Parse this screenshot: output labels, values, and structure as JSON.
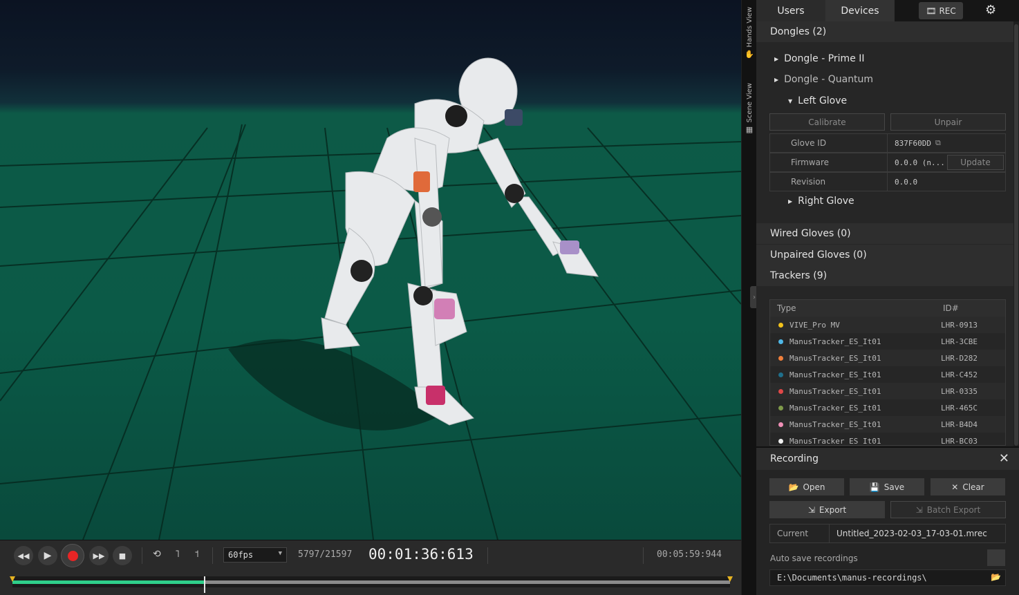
{
  "side_tabs": [
    {
      "label": "Hands View",
      "icon": "hand-icon"
    },
    {
      "label": "Scene View",
      "icon": "grid-icon"
    }
  ],
  "top_tabs": {
    "users": "Users",
    "devices": "Devices",
    "rec": "REC"
  },
  "dongles": {
    "header": "Dongles (2)",
    "items": [
      "Dongle - Prime II",
      "Dongle - Quantum"
    ],
    "left_glove": "Left Glove",
    "calibrate": "Calibrate",
    "unpair": "Unpair",
    "props": [
      {
        "key": "Glove ID",
        "value": "837F60DD"
      },
      {
        "key": "Firmware",
        "value": "0.0.0 (n...",
        "action": "Update"
      },
      {
        "key": "Revision",
        "value": "0.0.0"
      }
    ],
    "right_glove": "Right Glove"
  },
  "wired_gloves": "Wired Gloves (0)",
  "unpaired_gloves": "Unpaired Gloves (0)",
  "trackers": {
    "header": "Trackers (9)",
    "columns": [
      "Type",
      "ID#"
    ],
    "rows": [
      {
        "type": "VIVE_Pro MV",
        "id": "LHR-0913",
        "color": "#f2c21b"
      },
      {
        "type": "ManusTracker_ES_It01",
        "id": "LHR-3CBE",
        "color": "#4fb7e6"
      },
      {
        "type": "ManusTracker_ES_It01",
        "id": "LHR-D282",
        "color": "#f0803c"
      },
      {
        "type": "ManusTracker_ES_It01",
        "id": "LHR-C452",
        "color": "#1f6f8b"
      },
      {
        "type": "ManusTracker_ES_It01",
        "id": "LHR-0335",
        "color": "#e04848"
      },
      {
        "type": "ManusTracker_ES_It01",
        "id": "LHR-465C",
        "color": "#7f9a4a"
      },
      {
        "type": "ManusTracker_ES_It01",
        "id": "LHR-B4D4",
        "color": "#ef8fb6"
      },
      {
        "type": "ManusTracker_ES_It01",
        "id": "LHR-BC03",
        "color": "#f0f0f0"
      }
    ]
  },
  "recording": {
    "title": "Recording",
    "open": "Open",
    "save": "Save",
    "clear": "Clear",
    "export": "Export",
    "batch_export": "Batch Export",
    "current_label": "Current",
    "current_value": "Untitled_2023-02-03_17-03-01.mrec",
    "autosave_label": "Auto save recordings",
    "path": "E:\\Documents\\manus-recordings\\"
  },
  "transport": {
    "fps": "60fps",
    "frame": "5797/21597",
    "timecode": "00:01:36:613",
    "total": "00:05:59:944",
    "progress": 0.268,
    "accent": "#2fcf8a"
  }
}
